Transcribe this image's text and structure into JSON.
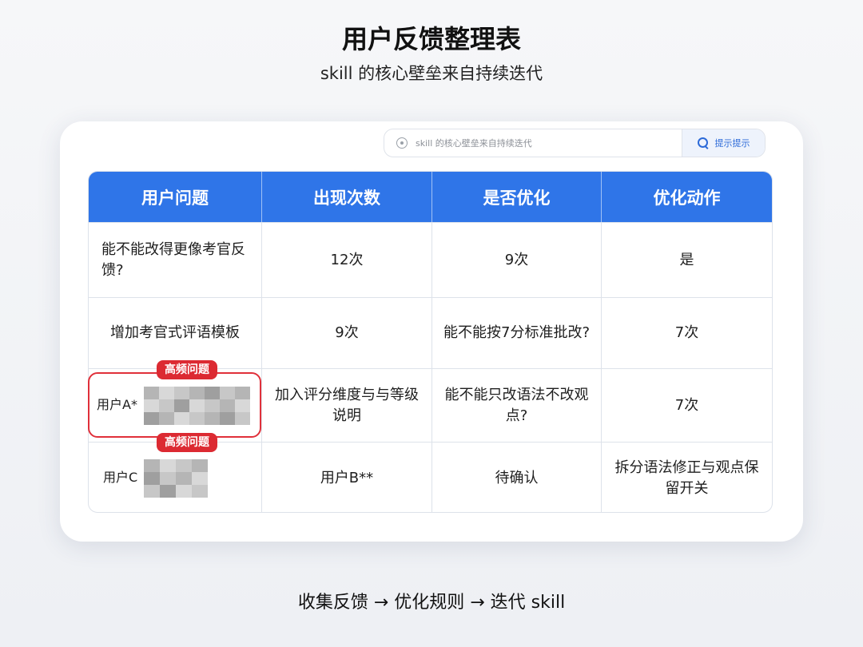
{
  "header": {
    "title": "用户反馈整理表",
    "subtitle": "skill 的核心壁垒来自持续迭代"
  },
  "search": {
    "placeholder": "skill 的核心壁垒来自持续迭代",
    "button_label": "提示提示"
  },
  "table": {
    "headers": [
      "用户问题",
      "出现次数",
      "是否优化",
      "优化动作"
    ],
    "rows": [
      [
        "能不能改得更像考官反馈?",
        "12次",
        "9次",
        "是"
      ],
      [
        "增加考官式评语模板",
        "9次",
        "能不能按7分标准批改?",
        "7次"
      ],
      [
        "用户A*",
        "加入评分维度与与等级说明",
        "能不能只改语法不改观点?",
        "7次"
      ],
      [
        "用户C",
        "用户B**",
        "待确认",
        "拆分语法修正与观点保留开关"
      ]
    ]
  },
  "tags": {
    "top": "高频问题",
    "bottom": "高频问题"
  },
  "footer": {
    "flow": "收集反馈 → 优化规则 → 迭代 skill"
  },
  "colors": {
    "header_blue": "#2f75e8",
    "highlight_red": "#e0303a",
    "tag_red": "#dc2a32"
  }
}
